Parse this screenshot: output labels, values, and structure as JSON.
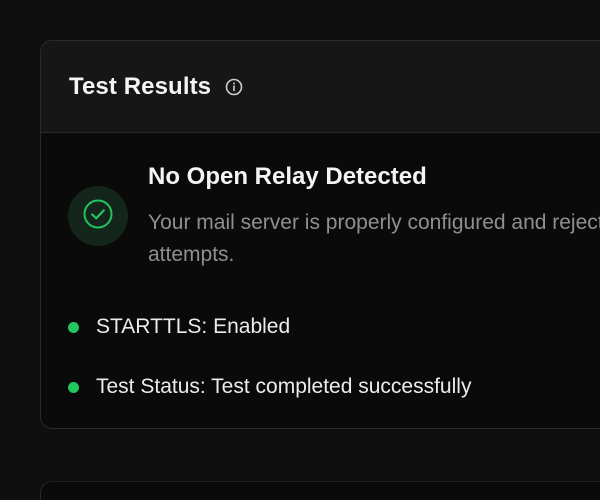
{
  "card": {
    "title": "Test Results",
    "info_icon": "info-icon"
  },
  "result": {
    "status_icon": "check-circle-icon",
    "title": "No Open Relay Detected",
    "description": "Your mail server is properly configured and rejects relay attempts."
  },
  "details": [
    {
      "label": "STARTTLS: Enabled"
    },
    {
      "label": "Test Status: Test completed successfully"
    }
  ],
  "colors": {
    "success": "#22c55e",
    "background": "#0f0f0f",
    "card": "#0a0a0a",
    "header": "#161616"
  }
}
